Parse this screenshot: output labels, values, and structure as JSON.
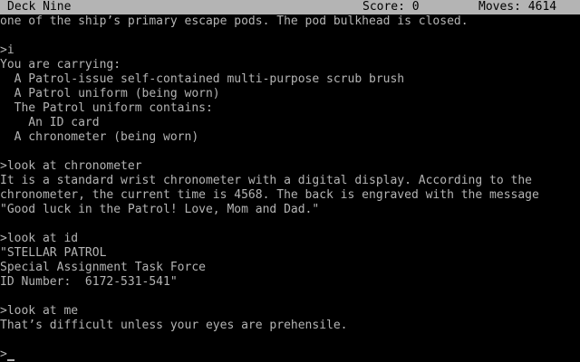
{
  "status_bar": {
    "location": "Deck Nine",
    "score_text": "Score: 0",
    "moves_text": "Moves: 4614"
  },
  "transcript": [
    "one of the ship’s primary escape pods. The pod bulkhead is closed.",
    "",
    ">i",
    "You are carrying:",
    "  A Patrol-issue self-contained multi-purpose scrub brush",
    "  A Patrol uniform (being worn)",
    "  The Patrol uniform contains:",
    "    An ID card",
    "  A chronometer (being worn)",
    "",
    ">look at chronometer",
    "It is a standard wrist chronometer with a digital display. According to the",
    "chronometer, the current time is 4568. The back is engraved with the message",
    "\"Good luck in the Patrol! Love, Mom and Dad.\"",
    "",
    ">look at id",
    "\"STELLAR PATROL",
    "Special Assignment Task Force",
    "ID Number:  6172-531-541\"",
    "",
    ">look at me",
    "That’s difficult unless your eyes are prehensile.",
    ""
  ],
  "prompt": {
    "symbol": ">",
    "input_value": ""
  },
  "colors": {
    "background": "#000000",
    "text": "#b4b4b4",
    "status_bg": "#b4b4b4",
    "status_text": "#000000"
  }
}
